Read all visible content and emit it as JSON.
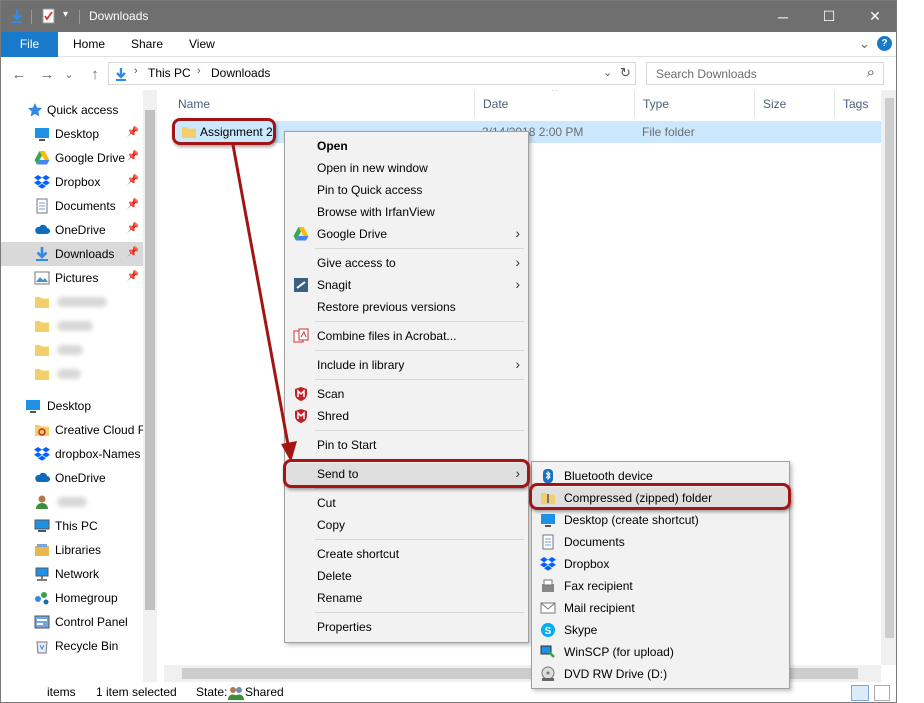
{
  "window": {
    "title": "Downloads",
    "minimize": "─",
    "maximize": "☐",
    "close": "✕"
  },
  "ribbon": {
    "tabs": [
      "File",
      "Home",
      "Share",
      "View"
    ],
    "expand": "⌄",
    "help": "?"
  },
  "address": {
    "back": "←",
    "forward": "→",
    "recent": "⌄",
    "up": "↑",
    "crumbs": [
      "This PC",
      "Downloads"
    ],
    "sep": "›",
    "dropdown": "⌄",
    "refresh": "↻",
    "search_placeholder": "Search Downloads",
    "search_icon": "⌕"
  },
  "sidebar": {
    "quick_access": "Quick access",
    "quick_items": [
      {
        "label": "Desktop",
        "icon": "desktop-icon"
      },
      {
        "label": "Google Drive",
        "icon": "google-drive-icon"
      },
      {
        "label": "Dropbox",
        "icon": "dropbox-icon"
      },
      {
        "label": "Documents",
        "icon": "documents-icon"
      },
      {
        "label": "OneDrive",
        "icon": "onedrive-icon"
      },
      {
        "label": "Downloads",
        "icon": "downloads-icon"
      },
      {
        "label": "Pictures",
        "icon": "pictures-icon"
      }
    ],
    "pin": "📌",
    "desktop_root": "Desktop",
    "desktop_items": [
      {
        "label": "Creative Cloud F",
        "icon": "creative-cloud-icon"
      },
      {
        "label": "dropbox-Names",
        "icon": "dropbox-icon"
      },
      {
        "label": "OneDrive",
        "icon": "onedrive-icon"
      },
      {
        "label": "",
        "icon": "user-icon"
      },
      {
        "label": "This PC",
        "icon": "this-pc-icon"
      },
      {
        "label": "Libraries",
        "icon": "libraries-icon"
      },
      {
        "label": "Network",
        "icon": "network-icon"
      },
      {
        "label": "Homegroup",
        "icon": "homegroup-icon"
      },
      {
        "label": "Control Panel",
        "icon": "control-panel-icon"
      },
      {
        "label": "Recycle Bin",
        "icon": "recycle-bin-icon"
      }
    ]
  },
  "columns": {
    "name": "Name",
    "date": "Date",
    "type": "Type",
    "size": "Size",
    "tags": "Tags",
    "sort": "⌃"
  },
  "file_row": {
    "name": "Assignment 2",
    "date": "3/14/2018 2:00 PM",
    "type": "File folder"
  },
  "context_menu": {
    "open": "Open",
    "open_new_window": "Open in new window",
    "pin_quick": "Pin to Quick access",
    "browse_irfan": "Browse with IrfanView",
    "google_drive": "Google Drive",
    "give_access": "Give access to",
    "snagit": "Snagit",
    "restore": "Restore previous versions",
    "combine": "Combine files in Acrobat...",
    "include_library": "Include in library",
    "scan": "Scan",
    "shred": "Shred",
    "pin_start": "Pin to Start",
    "send_to": "Send to",
    "cut": "Cut",
    "copy": "Copy",
    "create_shortcut": "Create shortcut",
    "delete": "Delete",
    "rename": "Rename",
    "properties": "Properties",
    "arrow": "›"
  },
  "send_to_menu": {
    "bluetooth": "Bluetooth device",
    "zip": "Compressed (zipped) folder",
    "desktop_shortcut": "Desktop (create shortcut)",
    "documents": "Documents",
    "dropbox": "Dropbox",
    "fax": "Fax recipient",
    "mail": "Mail recipient",
    "skype": "Skype",
    "winscp": "WinSCP (for upload)",
    "dvd": "DVD RW Drive (D:)"
  },
  "status": {
    "items": "items",
    "selected": "1 item selected",
    "state_label": "State:",
    "state_value": "Shared"
  },
  "colors": {
    "accent": "#1979ca",
    "selection": "#cce8ff",
    "annotation": "#a31515",
    "folder": "#f3cf6b"
  }
}
